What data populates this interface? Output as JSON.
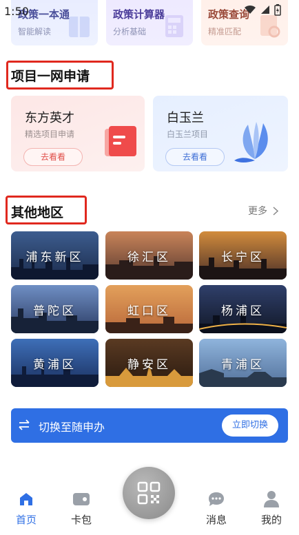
{
  "status": {
    "time": "1:50"
  },
  "top_cards": [
    {
      "title": "政策一本通",
      "subtitle": "智能解读"
    },
    {
      "title": "政策计算器",
      "subtitle": "分析基础"
    },
    {
      "title": "政策查询",
      "subtitle": "精准匹配"
    }
  ],
  "project_section": {
    "title": "项目一网申请",
    "cards": [
      {
        "title": "东方英才",
        "subtitle": "精选项目申请",
        "button": "去看看"
      },
      {
        "title": "白玉兰",
        "subtitle": "白玉兰项目",
        "button": "去看看"
      }
    ]
  },
  "region_section": {
    "title": "其他地区",
    "more_label": "更多",
    "regions": [
      "浦东新区",
      "徐汇区",
      "长宁区",
      "普陀区",
      "虹口区",
      "杨浦区",
      "黄浦区",
      "静安区",
      "青浦区"
    ]
  },
  "switch_bar": {
    "text": "切换至随申办",
    "button": "立即切换"
  },
  "bottom_nav": {
    "items": [
      {
        "label": "首页",
        "icon": "home-icon"
      },
      {
        "label": "卡包",
        "icon": "wallet-icon"
      },
      {
        "label": "消息",
        "icon": "message-icon"
      },
      {
        "label": "我的",
        "icon": "user-icon"
      }
    ],
    "scan_icon": "qr-scan-icon",
    "active_color": "#2f6fe4"
  },
  "colors": {
    "accent": "#2f6fe4",
    "highlight_box": "#e0281e"
  }
}
